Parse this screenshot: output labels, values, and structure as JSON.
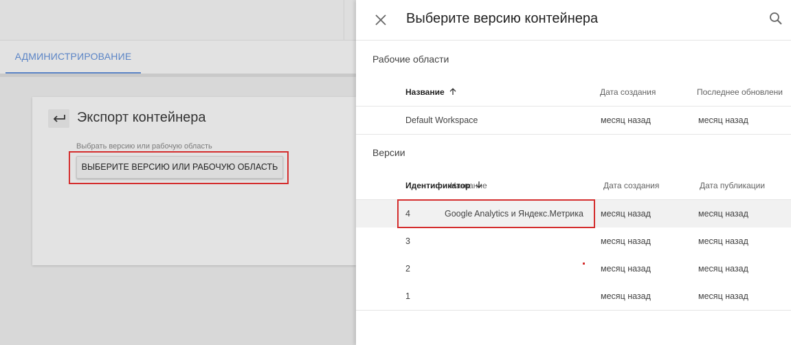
{
  "background": {
    "tab_admin": "АДМИНИСТРИРОВАНИЕ",
    "card": {
      "back_icon": "arrow-back-icon",
      "title": "Экспорт контейнера",
      "label": "Выбрать версию или рабочую область",
      "button": "ВЫБЕРИТЕ ВЕРСИЮ ИЛИ РАБОЧУЮ ОБЛАСТЬ"
    }
  },
  "panel": {
    "close_icon": "close-icon",
    "title": "Выберите версию контейнера",
    "search_icon": "search-icon",
    "workspaces": {
      "title": "Рабочие области",
      "headers": {
        "name": "Название",
        "created": "Дата создания",
        "updated": "Последнее обновлени"
      },
      "rows": [
        {
          "name": "Default Workspace",
          "created": "месяц назад",
          "updated": "месяц назад"
        }
      ]
    },
    "versions": {
      "title": "Версии",
      "headers": {
        "id": "Идентификатор",
        "name": "Название",
        "created": "Дата создания",
        "published": "Дата публикации"
      },
      "rows": [
        {
          "id": "4",
          "name": "Google Analytics и Яндекс.Метрика",
          "created": "месяц назад",
          "published": "месяц назад"
        },
        {
          "id": "3",
          "name": "",
          "created": "месяц назад",
          "published": "месяц назад"
        },
        {
          "id": "2",
          "name": "",
          "created": "месяц назад",
          "published": "месяц назад"
        },
        {
          "id": "1",
          "name": "",
          "created": "месяц назад",
          "published": "месяц назад"
        }
      ]
    }
  },
  "colors": {
    "accent": "#5a84c6",
    "highlight": "#d42d2d"
  }
}
